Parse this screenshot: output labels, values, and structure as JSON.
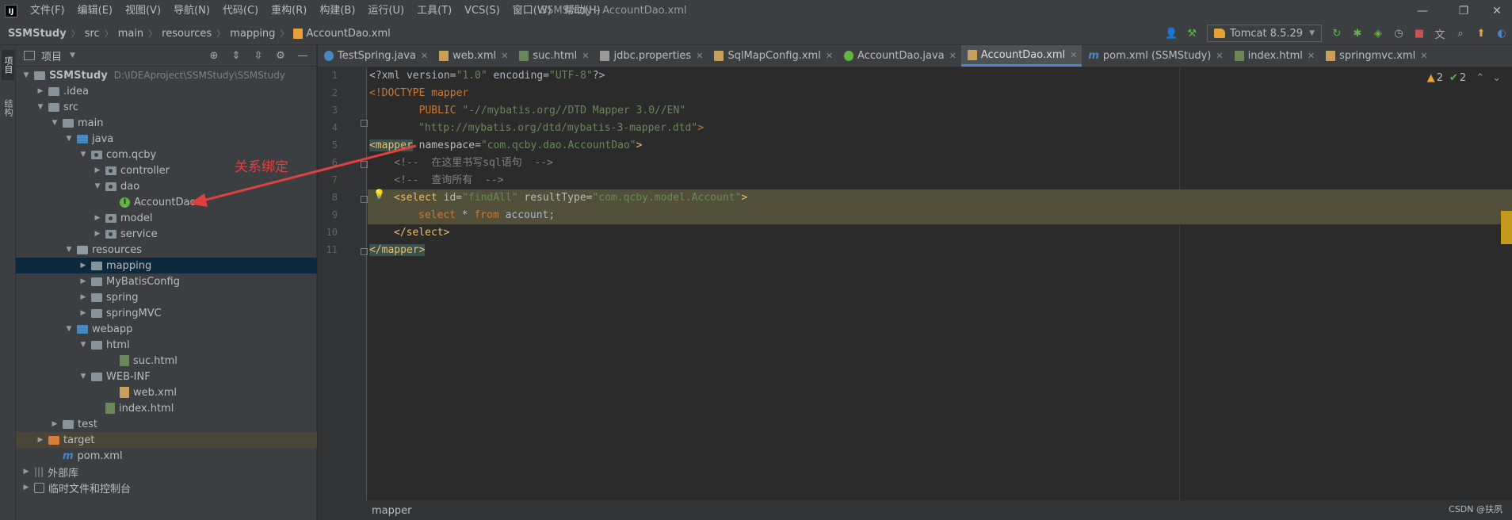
{
  "menubar": {
    "logo": "IJ",
    "items": [
      "文件(F)",
      "编辑(E)",
      "视图(V)",
      "导航(N)",
      "代码(C)",
      "重构(R)",
      "构建(B)",
      "运行(U)",
      "工具(T)",
      "VCS(S)",
      "窗口(W)",
      "帮助(H)"
    ],
    "window_title": "SSMStudy - AccountDao.xml"
  },
  "navbar": {
    "crumbs": [
      "SSMStudy",
      "src",
      "main",
      "resources",
      "mapping",
      "AccountDao.xml"
    ],
    "run_config": "Tomcat 8.5.29"
  },
  "left_stripe": {
    "project_tab": "项目",
    "structure_tab": "结构"
  },
  "project_panel": {
    "title": "项目",
    "tree": [
      {
        "label": "SSMStudy",
        "hint": "D:\\IDEAproject\\SSMStudy\\SSMStudy",
        "indent": 0,
        "arrow": "▼",
        "icon": "folder"
      },
      {
        "label": ".idea",
        "indent": 1,
        "arrow": "▶",
        "icon": "folder"
      },
      {
        "label": "src",
        "indent": 1,
        "arrow": "▼",
        "icon": "folder"
      },
      {
        "label": "main",
        "indent": 2,
        "arrow": "▼",
        "icon": "folder"
      },
      {
        "label": "java",
        "indent": 3,
        "arrow": "▼",
        "icon": "src"
      },
      {
        "label": "com.qcby",
        "indent": 4,
        "arrow": "▼",
        "icon": "pkg"
      },
      {
        "label": "controller",
        "indent": 5,
        "arrow": "▶",
        "icon": "pkg"
      },
      {
        "label": "dao",
        "indent": 5,
        "arrow": "▼",
        "icon": "pkg"
      },
      {
        "label": "AccountDao",
        "indent": 6,
        "arrow": "",
        "icon": "iface"
      },
      {
        "label": "model",
        "indent": 5,
        "arrow": "▶",
        "icon": "pkg"
      },
      {
        "label": "service",
        "indent": 5,
        "arrow": "▶",
        "icon": "pkg"
      },
      {
        "label": "resources",
        "indent": 3,
        "arrow": "▼",
        "icon": "res"
      },
      {
        "label": "mapping",
        "indent": 4,
        "arrow": "▶",
        "icon": "folder",
        "selected": true
      },
      {
        "label": "MyBatisConfig",
        "indent": 4,
        "arrow": "▶",
        "icon": "folder"
      },
      {
        "label": "spring",
        "indent": 4,
        "arrow": "▶",
        "icon": "folder"
      },
      {
        "label": "springMVC",
        "indent": 4,
        "arrow": "▶",
        "icon": "folder"
      },
      {
        "label": "webapp",
        "indent": 3,
        "arrow": "▼",
        "icon": "src"
      },
      {
        "label": "html",
        "indent": 4,
        "arrow": "▼",
        "icon": "folder"
      },
      {
        "label": "suc.html",
        "indent": 6,
        "arrow": "",
        "icon": "html"
      },
      {
        "label": "WEB-INF",
        "indent": 4,
        "arrow": "▼",
        "icon": "folder"
      },
      {
        "label": "web.xml",
        "indent": 6,
        "arrow": "",
        "icon": "xml"
      },
      {
        "label": "index.html",
        "indent": 5,
        "arrow": "",
        "icon": "html"
      },
      {
        "label": "test",
        "indent": 2,
        "arrow": "▶",
        "icon": "folder"
      },
      {
        "label": "target",
        "indent": 1,
        "arrow": "▶",
        "icon": "orange",
        "excluded": true
      },
      {
        "label": "pom.xml",
        "indent": 2,
        "arrow": "",
        "icon": "maven"
      },
      {
        "label": "外部库",
        "indent": 0,
        "arrow": "▶",
        "icon": "lib"
      },
      {
        "label": "临时文件和控制台",
        "indent": 0,
        "arrow": "▶",
        "icon": "scratch"
      }
    ]
  },
  "annotation": {
    "text": "关系绑定",
    "color": "#e04040"
  },
  "tabs": [
    {
      "label": "TestSpring.java",
      "icon": "java"
    },
    {
      "label": "web.xml",
      "icon": "xml"
    },
    {
      "label": "suc.html",
      "icon": "html"
    },
    {
      "label": "jdbc.properties",
      "icon": "props"
    },
    {
      "label": "SqlMapConfig.xml",
      "icon": "xml"
    },
    {
      "label": "AccountDao.java",
      "icon": "iface"
    },
    {
      "label": "AccountDao.xml",
      "icon": "xml",
      "active": true
    },
    {
      "label": "pom.xml (SSMStudy)",
      "icon": "maven"
    },
    {
      "label": "index.html",
      "icon": "html"
    },
    {
      "label": "springmvc.xml",
      "icon": "xml"
    }
  ],
  "editor": {
    "inspections": {
      "warnings": "2",
      "weak_warnings": "2"
    },
    "lines": [
      {
        "num": "1"
      },
      {
        "num": "2"
      },
      {
        "num": "3"
      },
      {
        "num": "4"
      },
      {
        "num": "5"
      },
      {
        "num": "6"
      },
      {
        "num": "7"
      },
      {
        "num": "8"
      },
      {
        "num": "9"
      },
      {
        "num": "10"
      },
      {
        "num": "11"
      }
    ],
    "code": {
      "l1_a": "<?xml version=",
      "l1_b": "\"1.0\"",
      "l1_c": " encoding=",
      "l1_d": "\"UTF-8\"",
      "l1_e": "?>",
      "l2": "<!DOCTYPE mapper",
      "l3_a": "        PUBLIC ",
      "l3_b": "\"-//mybatis.org//DTD Mapper 3.0//EN\"",
      "l4": "\"http://mybatis.org/dtd/mybatis-3-mapper.dtd\"",
      "l4_close": ">",
      "l5_tag": "<mapper",
      "l5_attr": " namespace=",
      "l5_val": "\"com.qcby.dao.AccountDao\"",
      "l5_end": ">",
      "l6": "    <!--  在这里书写sql语句  -->",
      "l7": "    <!--  查询所有  -->",
      "l8_tag": "<select",
      "l8_attr1": " id=",
      "l8_val1": "\"findAll\"",
      "l8_attr2": " resultType=",
      "l8_val2": "\"com.qcby.model.Account\"",
      "l8_end": ">",
      "l9_kw1": "select",
      "l9_mid": " * ",
      "l9_kw2": "from",
      "l9_tail": " account;",
      "l10": "</select>",
      "l11": "</mapper>"
    }
  },
  "editor_breadcrumb": "mapper",
  "watermark": "CSDN @扶夙"
}
